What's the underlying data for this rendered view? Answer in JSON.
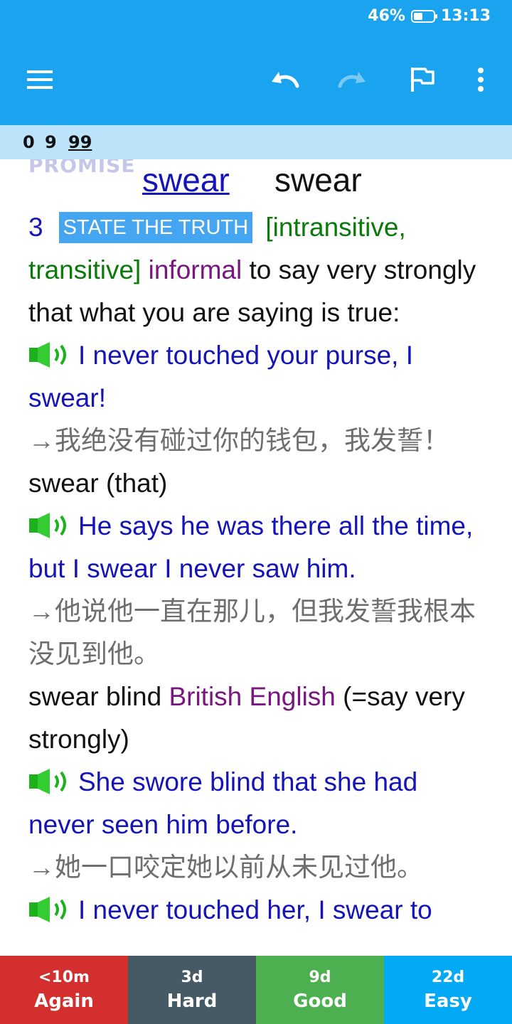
{
  "status_bar": {
    "battery": "46%",
    "battery_level": 0.46,
    "time": "13:13"
  },
  "toolbar": {
    "icons": [
      "menu-icon",
      "undo-icon",
      "redo-icon",
      "flag-icon",
      "more-vert-icon"
    ]
  },
  "counts": {
    "new": "0",
    "learning": "9",
    "review": "99"
  },
  "card": {
    "category": "PROMISE",
    "headword_link": "swear",
    "headword": "swear",
    "sense_number": "3",
    "signpost": "STATE THE TRUTH",
    "grammar": "[intransitive, transitive]",
    "register": "informal",
    "definition": "to say very strongly that what you are saying is true:",
    "example1": "I never touched your purse, I swear!",
    "translation1": "→我绝没有碰过你的钱包，我发誓！",
    "pattern1": "swear (that)",
    "example2": "He says he was there all the time, but I swear I never saw him.",
    "translation2": "→他说他一直在那儿，但我发誓我根本没见到他。",
    "pattern2": "swear blind",
    "pattern2_region": "British English",
    "pattern2_gloss": "(=say very strongly)",
    "example3": "She swore blind that she had never seen him before.",
    "translation3": "→她一口咬定她以前从未见过他。",
    "example4": "I never touched her, I swear to"
  },
  "answer_buttons": [
    {
      "time": "<10m",
      "label": "Again",
      "color": "#D32F2F"
    },
    {
      "time": "3d",
      "label": "Hard",
      "color": "#455A64"
    },
    {
      "time": "9d",
      "label": "Good",
      "color": "#4CAF50"
    },
    {
      "time": "22d",
      "label": "Easy",
      "color": "#03A9F4"
    }
  ],
  "colors": {
    "appbar": "#1AA3EE",
    "counts_bar": "#BCE3FA"
  }
}
